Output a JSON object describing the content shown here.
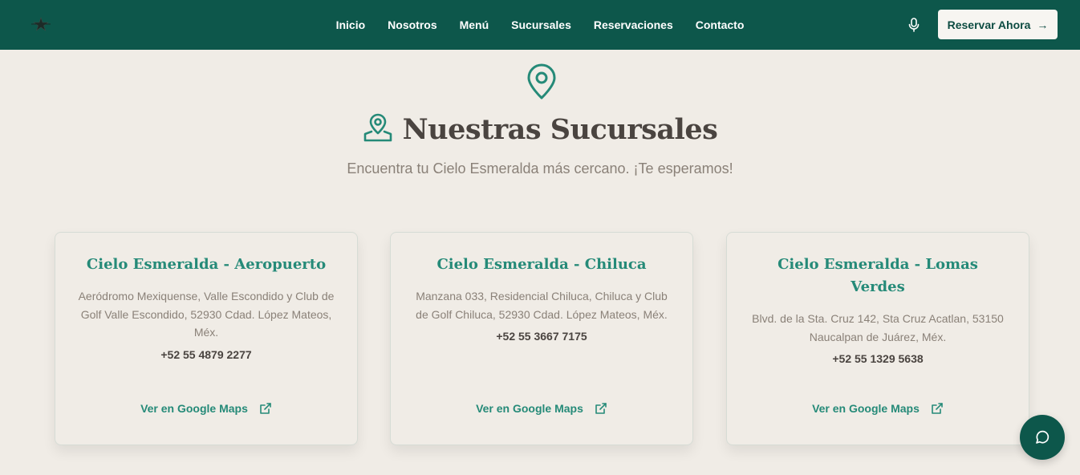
{
  "nav": {
    "logo_icon": "star-logo-icon",
    "links": [
      "Inicio",
      "Nosotros",
      "Menú",
      "Sucursales",
      "Reservaciones",
      "Contacto"
    ],
    "mic_icon": "microphone-icon",
    "reserve_label": "Reservar Ahora",
    "reserve_arrow": "→"
  },
  "header": {
    "top_icon": "map-pin-icon",
    "title_icon": "map-user-pin-icon",
    "title": "Nuestras Sucursales",
    "subtitle": "Encuentra tu Cielo Esmeralda más cercano. ¡Te esperamos!"
  },
  "branches": [
    {
      "name": "Cielo Esmeralda - Aeropuerto",
      "address": "Aeródromo Mexiquense, Valle Escondido y Club de Golf Valle Escondido, 52930 Cdad. López Mateos, Méx.",
      "phone": "+52 55 4879 2277",
      "maps_label": "Ver en Google Maps"
    },
    {
      "name": "Cielo Esmeralda - Chiluca",
      "address": "Manzana 033, Residencial Chiluca, Chiluca y Club de Golf Chiluca, 52930 Cdad. López Mateos, Méx.",
      "phone": "+52 55 3667 7175",
      "maps_label": "Ver en Google Maps"
    },
    {
      "name": "Cielo Esmeralda - Lomas Verdes",
      "address": "Blvd. de la Sta. Cruz 142, Sta Cruz Acatlan, 53150 Naucalpan de Juárez, Méx.",
      "phone": "+52 55 1329 5638",
      "maps_label": "Ver en Google Maps"
    }
  ],
  "chat": {
    "icon": "chat-bubble-icon"
  },
  "colors": {
    "primary": "#0d574b",
    "accent": "#258a78",
    "background": "#f0ece6",
    "text": "#4a4440",
    "muted": "#8a8178"
  }
}
